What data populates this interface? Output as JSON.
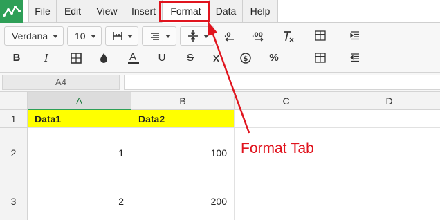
{
  "menu": {
    "items": [
      {
        "label": "File"
      },
      {
        "label": "Edit"
      },
      {
        "label": "View"
      },
      {
        "label": "Insert"
      },
      {
        "label": "Format"
      },
      {
        "label": "Data"
      },
      {
        "label": "Help"
      }
    ],
    "active": "Format"
  },
  "toolbar": {
    "font_name": "Verdana",
    "font_size": "10",
    "percent_label": "%"
  },
  "formula_bar": {
    "name_box": "A4",
    "formula_value": ""
  },
  "grid": {
    "columns": [
      "A",
      "B",
      "C",
      "D"
    ],
    "selected_column": "A",
    "rows": [
      {
        "number": "1",
        "cells": [
          "Data1",
          "Data2",
          "",
          ""
        ]
      },
      {
        "number": "2",
        "cells": [
          "1",
          "100",
          "",
          ""
        ]
      },
      {
        "number": "3",
        "cells": [
          "2",
          "200",
          "",
          ""
        ]
      }
    ]
  },
  "annotation": {
    "text": "Format Tab",
    "color": "#e0141e"
  },
  "colors": {
    "brand": "#2e9f57",
    "header_fill": "#ffff00"
  }
}
